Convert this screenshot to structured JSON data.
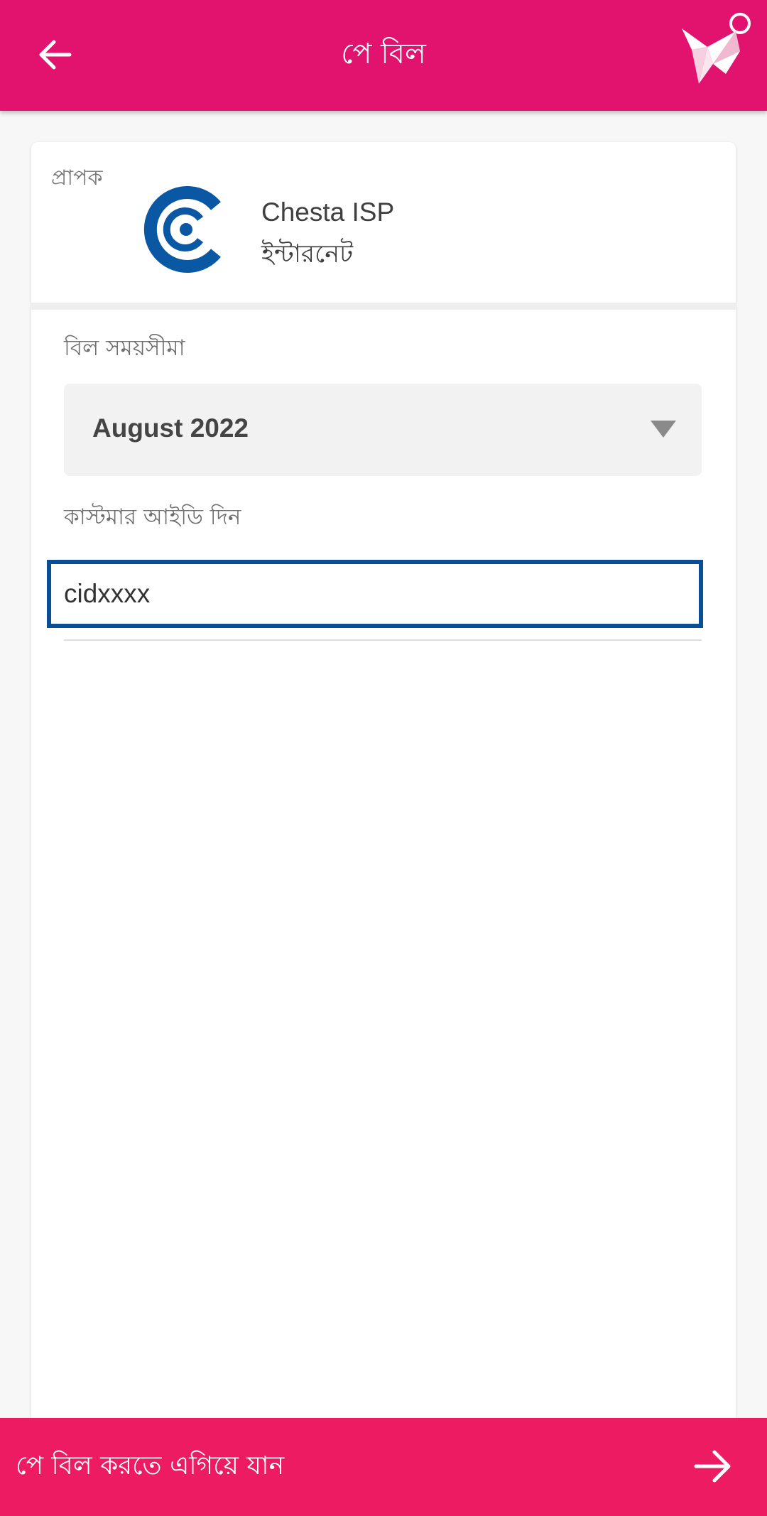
{
  "header": {
    "title": "পে বিল"
  },
  "recipient": {
    "label": "প্রাপক",
    "name": "Chesta ISP",
    "category": "ইন্টারনেট"
  },
  "bill_period": {
    "label": "বিল সময়সীমা",
    "selected": "August 2022"
  },
  "customer_id": {
    "label": "কাস্টমার আইডি দিন",
    "value": "cidxxxx"
  },
  "footer": {
    "proceed_label": "পে বিল করতে এগিয়ে যান"
  },
  "colors": {
    "brand": "#e2136e",
    "action_bar": "#ec1b62",
    "input_focus": "#0b4e94",
    "provider_logo": "#0a57a4"
  },
  "icons": {
    "back": "arrow-left-icon",
    "logo": "origami-bird-logo-icon",
    "dropdown": "triangle-down-icon",
    "proceed": "arrow-right-icon"
  }
}
